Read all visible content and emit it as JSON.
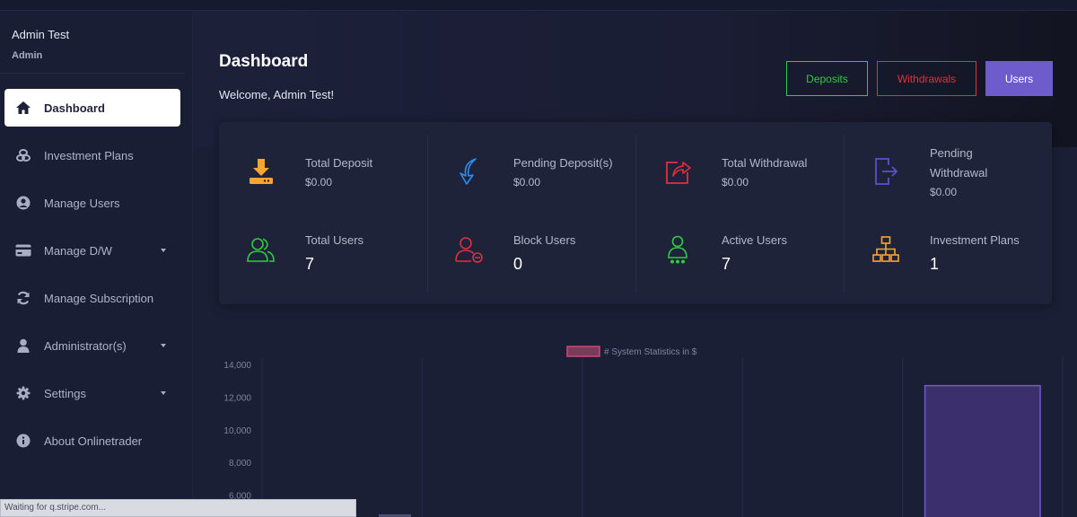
{
  "user": {
    "name": "Admin Test",
    "role": "Admin"
  },
  "sidebar": {
    "items": [
      {
        "label": "Dashboard",
        "icon": "home-icon",
        "active": true
      },
      {
        "label": "Investment Plans",
        "icon": "coins-icon"
      },
      {
        "label": "Manage Users",
        "icon": "user-circle-icon"
      },
      {
        "label": "Manage D/W",
        "icon": "credit-card-icon",
        "has_caret": true
      },
      {
        "label": "Manage Subscription",
        "icon": "refresh-icon"
      },
      {
        "label": "Administrator(s)",
        "icon": "user-icon",
        "has_caret": true
      },
      {
        "label": "Settings",
        "icon": "gear-icon",
        "has_caret": true
      },
      {
        "label": "About Onlinetrader",
        "icon": "info-icon"
      }
    ]
  },
  "header": {
    "title": "Dashboard",
    "welcome": "Welcome, Admin Test!",
    "buttons": {
      "deposits": "Deposits",
      "withdrawals": "Withdrawals",
      "users": "Users"
    }
  },
  "stats": [
    {
      "title": "Total Deposit",
      "value": "$0.00",
      "icon": "download-icon",
      "color": "#f7a531"
    },
    {
      "title": "Pending Deposit(s)",
      "value": "$0.00",
      "icon": "curved-arrow-down-icon",
      "color": "#2d8cf0"
    },
    {
      "title": "Total Withdrawal",
      "value": "$0.00",
      "icon": "share-out-icon",
      "color": "#e0303d"
    },
    {
      "title": "Pending",
      "title2": "Withdrawal",
      "value": "$0.00",
      "icon": "sign-out-icon",
      "color": "#5b4fd6"
    },
    {
      "title": "Total Users",
      "value": "7",
      "icon": "users-icon",
      "color": "#2ecc40"
    },
    {
      "title": "Block Users",
      "value": "0",
      "icon": "user-minus-icon",
      "color": "#e0303d"
    },
    {
      "title": "Active Users",
      "value": "7",
      "icon": "user-active-icon",
      "color": "#2ecc40"
    },
    {
      "title": "Investment Plans",
      "value": "1",
      "icon": "sitemap-icon",
      "color": "#f7a531"
    }
  ],
  "chart_data": {
    "type": "bar",
    "series": [
      {
        "name": "# System Statistics in $",
        "values": [
          0,
          0,
          0,
          0,
          12700
        ]
      }
    ],
    "categories": [
      "",
      "",
      "",
      "",
      ""
    ],
    "y_ticks": [
      "14,000",
      "12,000",
      "10,000",
      "8,000",
      "6,000"
    ],
    "ylim": [
      4000,
      14000
    ],
    "legend": "top-center",
    "grid": true,
    "colors": {
      "bar_fill": "#3b2f6e",
      "bar_stroke": "#6e5ccd",
      "legend_fill": "#7a3a5a",
      "legend_stroke": "#d0476f"
    }
  },
  "status_bar": {
    "text": "Waiting for q.stripe.com..."
  }
}
